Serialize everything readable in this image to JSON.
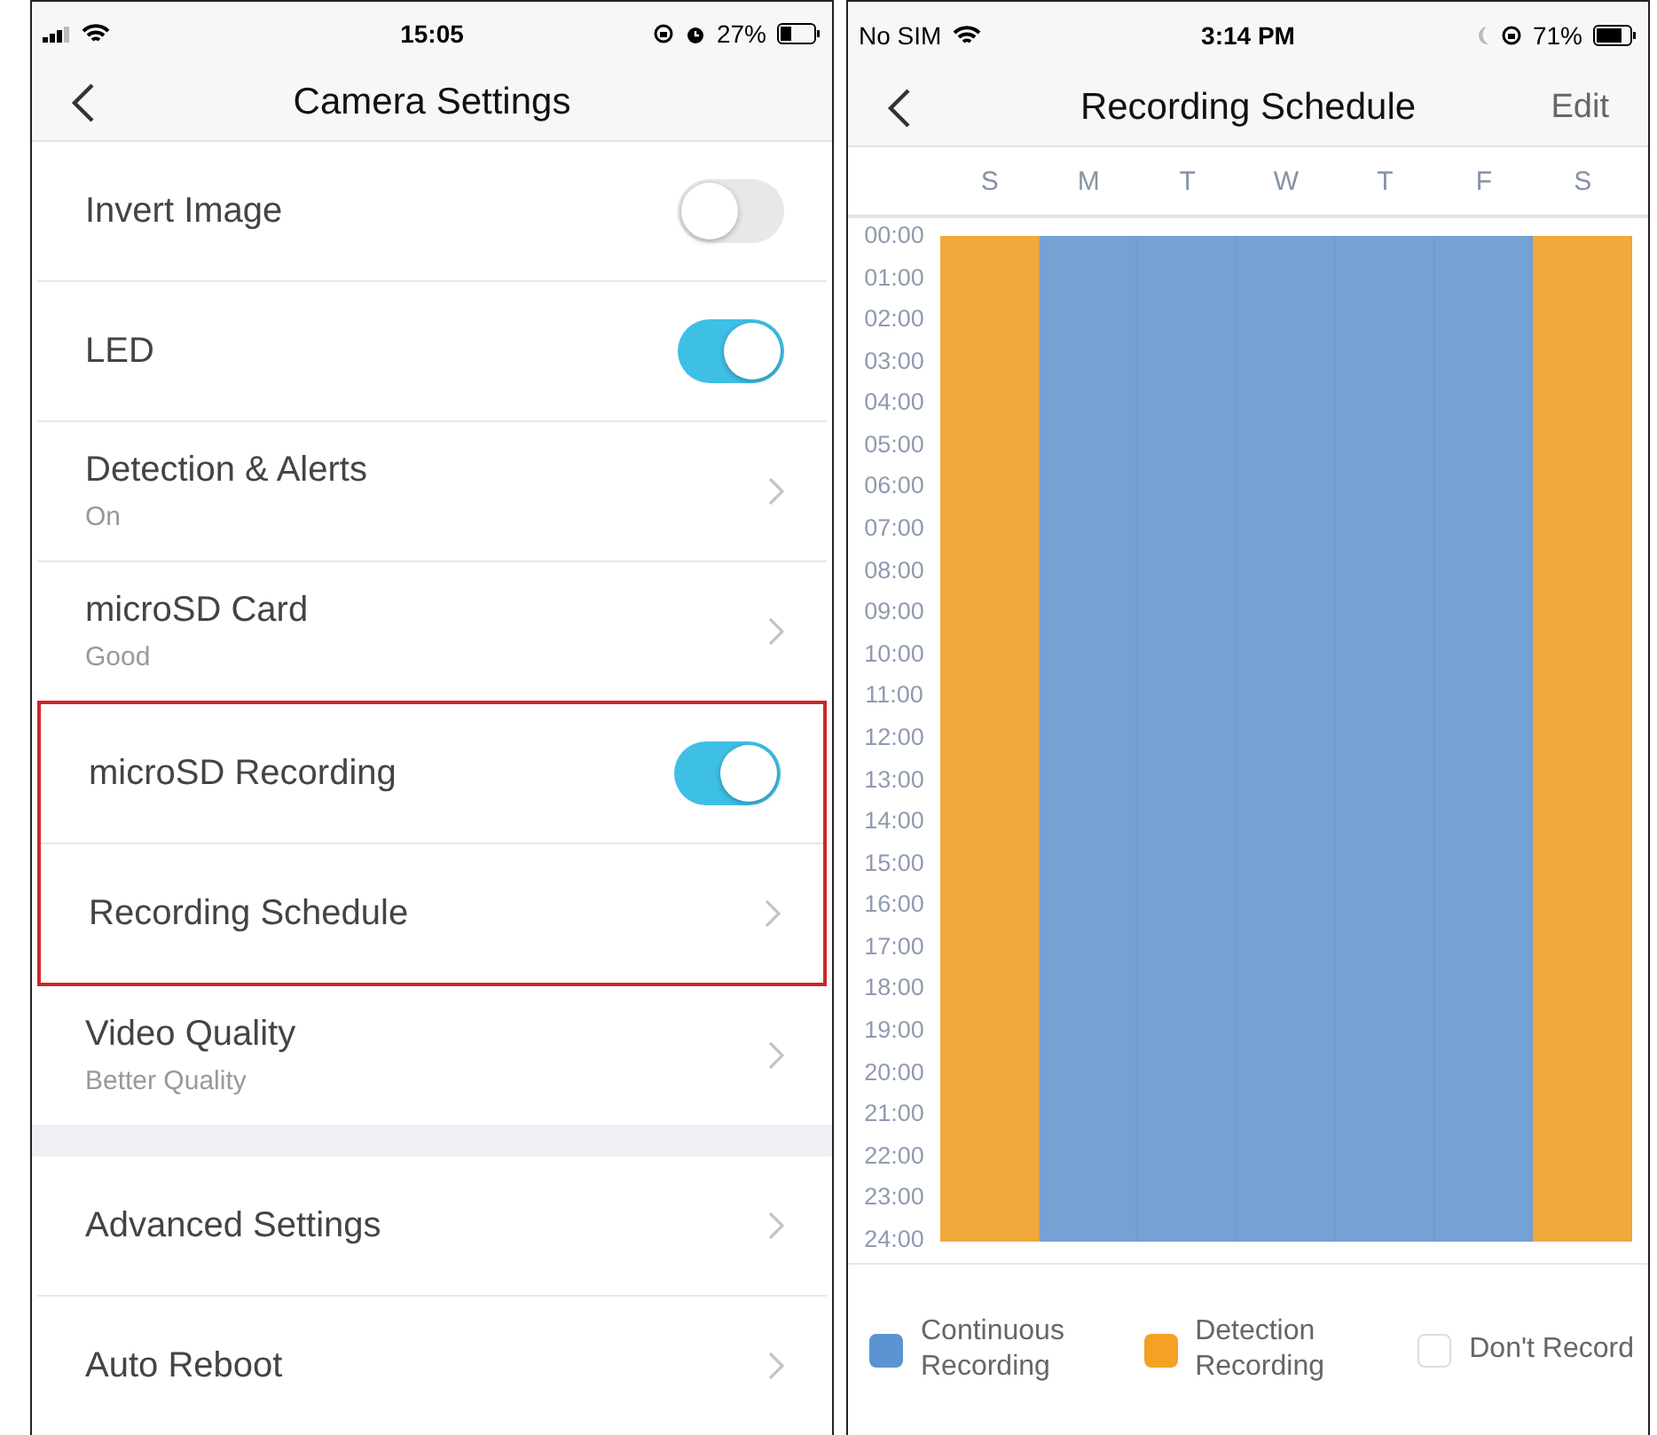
{
  "left_phone": {
    "status_bar": {
      "time": "15:05",
      "battery": "27%"
    },
    "nav": {
      "title": "Camera Settings"
    },
    "sections": [
      {
        "highlighted": false,
        "items": [
          {
            "kind": "toggle",
            "label": "Invert Image",
            "on": false
          },
          {
            "kind": "toggle",
            "label": "LED",
            "on": true
          },
          {
            "kind": "link",
            "label": "Detection & Alerts",
            "subtitle": "On"
          },
          {
            "kind": "link",
            "label": "microSD Card",
            "subtitle": "Good"
          }
        ]
      },
      {
        "highlighted": true,
        "items": [
          {
            "kind": "toggle",
            "label": "microSD Recording",
            "on": true
          },
          {
            "kind": "link",
            "label": "Recording Schedule"
          }
        ]
      },
      {
        "highlighted": false,
        "items": [
          {
            "kind": "link",
            "label": "Video Quality",
            "subtitle": "Better Quality"
          }
        ]
      },
      {
        "highlighted": false,
        "gap": true,
        "items": [
          {
            "kind": "link",
            "label": "Advanced Settings"
          },
          {
            "kind": "link",
            "label": "Auto Reboot"
          }
        ]
      }
    ]
  },
  "right_phone": {
    "status_bar": {
      "carrier": "No SIM",
      "time": "3:14 PM",
      "battery": "71%"
    },
    "nav": {
      "title": "Recording Schedule",
      "action": "Edit"
    },
    "days": [
      {
        "label": "S",
        "color": "#f2a93c"
      },
      {
        "label": "M",
        "color": "#76a1d4"
      },
      {
        "label": "T",
        "color": "#76a1d4"
      },
      {
        "label": "W",
        "color": "#76a1d4"
      },
      {
        "label": "T",
        "color": "#76a1d4"
      },
      {
        "label": "F",
        "color": "#76a1d4"
      },
      {
        "label": "S",
        "color": "#f2a93c"
      }
    ],
    "hours": [
      "00:00",
      "01:00",
      "02:00",
      "03:00",
      "04:00",
      "05:00",
      "06:00",
      "07:00",
      "08:00",
      "09:00",
      "10:00",
      "11:00",
      "12:00",
      "13:00",
      "14:00",
      "15:00",
      "16:00",
      "17:00",
      "18:00",
      "19:00",
      "20:00",
      "21:00",
      "22:00",
      "23:00",
      "24:00"
    ],
    "legend": [
      {
        "kind": "continuous",
        "label": "Continuous Recording",
        "color": "#5b93d3"
      },
      {
        "kind": "detection",
        "label": "Detection Recording",
        "color": "#f4a124"
      },
      {
        "kind": "none",
        "label": "Don't Record",
        "color": "#ffffff"
      }
    ]
  }
}
